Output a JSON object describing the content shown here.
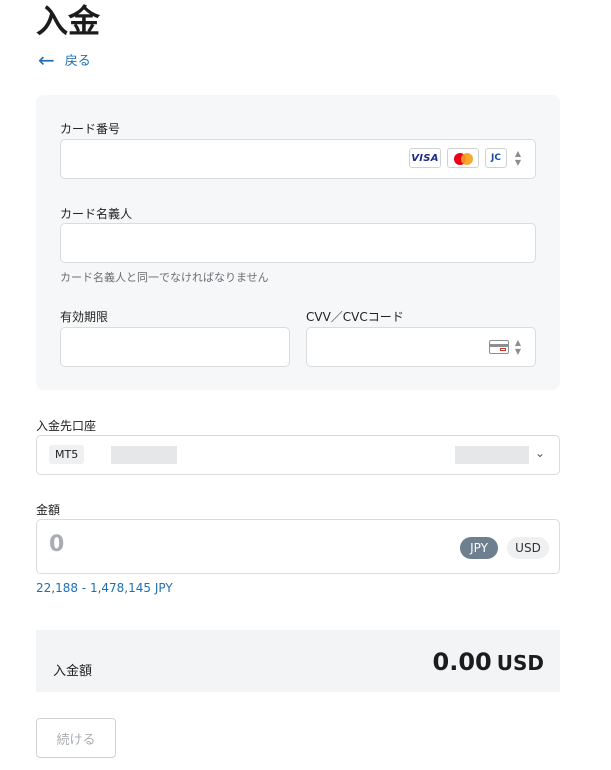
{
  "page": {
    "title": "入金",
    "back_label": "戻る"
  },
  "card_form": {
    "card_number_label": "カード番号",
    "card_number_value": "",
    "card_brands": [
      "VISA",
      "Mastercard",
      "JCB"
    ],
    "cardholder_label": "カード名義人",
    "cardholder_value": "",
    "cardholder_hint": "カード名義人と同一でなければなりません",
    "expiry_label": "有効期限",
    "expiry_value": "",
    "cvv_label": "CVV／CVCコード",
    "cvv_value": ""
  },
  "account": {
    "label": "入金先口座",
    "platform_badge": "MT5"
  },
  "amount": {
    "label": "金額",
    "value": "0",
    "currencies": [
      "JPY",
      "USD"
    ],
    "selected_currency": "JPY",
    "range_text": "22,188 - 1,478,145 JPY"
  },
  "total": {
    "label": "入金額",
    "value": "0.00",
    "currency": "USD"
  },
  "actions": {
    "continue_label": "続ける"
  },
  "colors": {
    "link": "#1f6fb2",
    "selected_currency_bg": "#6e7f8f",
    "panel_bg": "#f6f7f8"
  }
}
